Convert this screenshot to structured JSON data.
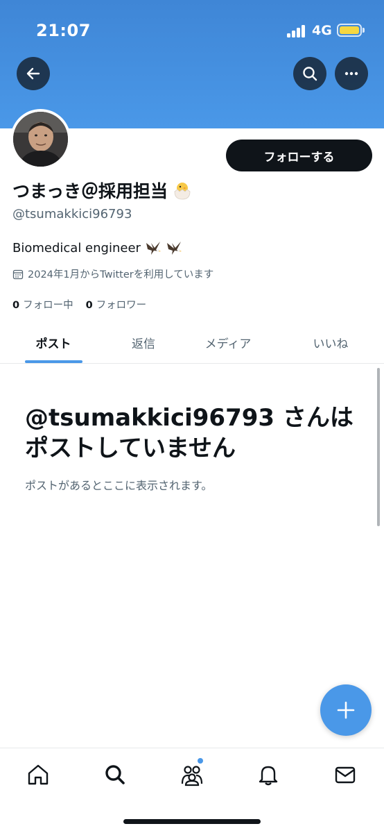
{
  "status_bar": {
    "time": "21:07",
    "network": "4G"
  },
  "header": {
    "back_icon": "arrow-left-icon",
    "search_icon": "search-icon",
    "more_icon": "more-horizontal-icon",
    "banner_color": "#4a98e8"
  },
  "profile": {
    "follow_button": "フォローする",
    "display_name": "つまっき＠採用担当",
    "display_name_emoji_icon": "hatching-chick-icon",
    "handle": "@tsumakkici96793",
    "bio": "Biomedical engineer",
    "bio_emoji_icon": "eagle-icon",
    "joined": "2024年1月からTwitterを利用しています",
    "following_count": "0",
    "following_label": "フォロー中",
    "followers_count": "0",
    "followers_label": "フォロワー"
  },
  "tabs": [
    {
      "label": "ポスト",
      "active": true
    },
    {
      "label": "返信",
      "active": false
    },
    {
      "label": "メディア",
      "active": false
    },
    {
      "label": "いいね",
      "active": false
    }
  ],
  "empty_state": {
    "title": "@tsumakkici96793 さんはポストしていません",
    "subtitle": "ポストがあるとここに表示されます。"
  },
  "fab": {
    "icon": "plus-icon"
  },
  "bottom_nav": [
    {
      "icon": "home-icon"
    },
    {
      "icon": "search-icon"
    },
    {
      "icon": "communities-icon",
      "has_dot": true
    },
    {
      "icon": "bell-icon"
    },
    {
      "icon": "mail-icon"
    }
  ],
  "colors": {
    "accent": "#4a98e8",
    "text": "#0f1419",
    "secondary": "#536471"
  }
}
